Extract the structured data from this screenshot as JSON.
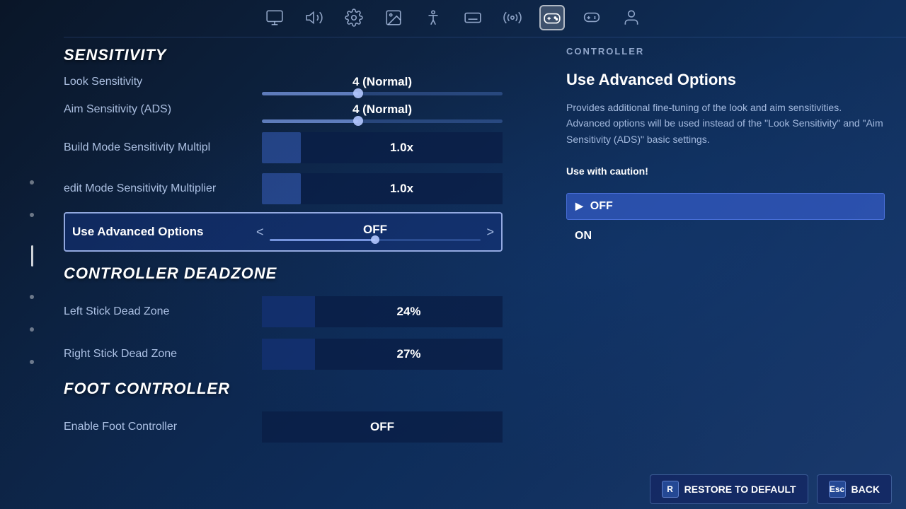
{
  "nav": {
    "icons": [
      {
        "name": "monitor-icon",
        "label": "Video"
      },
      {
        "name": "audio-icon",
        "label": "Audio"
      },
      {
        "name": "gear-icon",
        "label": "Settings"
      },
      {
        "name": "image-icon",
        "label": "Display"
      },
      {
        "name": "accessibility-icon",
        "label": "Accessibility"
      },
      {
        "name": "keyboard-icon",
        "label": "Keyboard"
      },
      {
        "name": "network-icon",
        "label": "Network"
      },
      {
        "name": "controller-icon",
        "label": "Controller",
        "active": true
      },
      {
        "name": "gamepad-icon",
        "label": "Gamepad"
      },
      {
        "name": "account-icon",
        "label": "Account"
      }
    ]
  },
  "sections": {
    "sensitivity": {
      "header": "SENSITIVITY",
      "items": [
        {
          "label": "Look Sensitivity",
          "value": "4 (Normal)",
          "slider_pct": 40
        },
        {
          "label": "Aim Sensitivity (ADS)",
          "value": "4 (Normal)",
          "slider_pct": 40
        },
        {
          "label": "Build Mode Sensitivity Multiplier",
          "value": "1.0x"
        },
        {
          "label": "Edit Mode Sensitivity Multiplier",
          "value": "1.0x"
        }
      ]
    },
    "advanced_options": {
      "label": "Use Advanced Options",
      "value": "OFF",
      "left_arrow": "<",
      "right_arrow": ">"
    },
    "deadzone": {
      "header": "CONTROLLER DEADZONE",
      "items": [
        {
          "label": "Left Stick Dead Zone",
          "value": "24%"
        },
        {
          "label": "Right Stick Dead Zone",
          "value": "27%"
        }
      ]
    },
    "foot_controller": {
      "header": "FOOT CONTROLLER",
      "items": [
        {
          "label": "Enable Foot Controller",
          "value": "OFF"
        }
      ]
    }
  },
  "right_panel": {
    "section_title": "CONTROLLER",
    "heading": "Use Advanced Options",
    "description": "Provides additional fine-tuning of the look and aim sensitivities.  Advanced options will be used instead of the \"Look Sensitivity\" and \"Aim Sensitivity (ADS)\" basic settings.",
    "caution": "Use with caution!",
    "options": [
      {
        "label": "OFF",
        "selected": true
      },
      {
        "label": "ON",
        "selected": false
      }
    ]
  },
  "bottom_bar": {
    "restore_btn": {
      "icon": "R",
      "label": "RESTORE TO DEFAULT"
    },
    "back_btn": {
      "icon": "Esc",
      "label": "BACK"
    }
  },
  "sidebar": {
    "dots": 5
  }
}
